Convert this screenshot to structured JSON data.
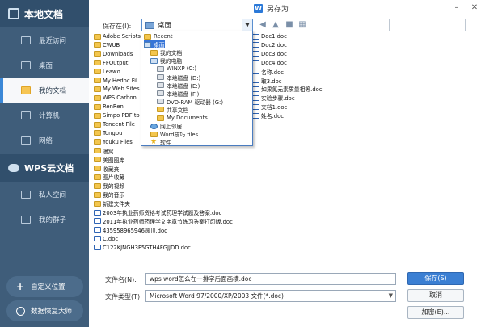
{
  "window": {
    "title": "另存为",
    "app_icon": "W",
    "minimize": "–",
    "close": "✕"
  },
  "sidebar": {
    "header": "本地文档",
    "items": [
      {
        "label": "最近访问"
      },
      {
        "label": "桌面"
      },
      {
        "label": "我的文档"
      },
      {
        "label": "计算机"
      },
      {
        "label": "网络"
      }
    ],
    "cloud_header": "WPS云文档",
    "cloud_items": [
      {
        "label": "私人空间"
      },
      {
        "label": "我的群子"
      }
    ],
    "add_location": "自定义位置",
    "recovery": "数据恢复大师"
  },
  "toolbar": {
    "save_in_label": "保存在(I):",
    "location": "桌面",
    "combo_arrow": "▼",
    "back_icon": "◀",
    "up_icon": "▲",
    "new_folder_icon": "■",
    "view_icon": "▦"
  },
  "files_left": [
    {
      "name": "Adobe Scripts",
      "type": "folder"
    },
    {
      "name": "CWUB",
      "type": "folder"
    },
    {
      "name": "Downloads",
      "type": "folder"
    },
    {
      "name": "FFOutput",
      "type": "folder"
    },
    {
      "name": "Leawo",
      "type": "folder"
    },
    {
      "name": "My Hedoc Fil",
      "type": "folder"
    },
    {
      "name": "My Web Sites",
      "type": "folder"
    },
    {
      "name": "WPS Carbon",
      "type": "folder"
    },
    {
      "name": "RenRen",
      "type": "folder"
    },
    {
      "name": "Simpo PDF to",
      "type": "folder"
    },
    {
      "name": "Tencent File",
      "type": "folder"
    },
    {
      "name": "Tongbu",
      "type": "folder"
    },
    {
      "name": "Youku Files",
      "type": "folder"
    },
    {
      "name": "漫窝",
      "type": "folder"
    },
    {
      "name": "美图图库",
      "type": "folder"
    },
    {
      "name": "收藏夹",
      "type": "folder"
    },
    {
      "name": "图片收藏",
      "type": "folder"
    },
    {
      "name": "我的视频",
      "type": "folder"
    },
    {
      "name": "我的音乐",
      "type": "folder"
    },
    {
      "name": "新建文件夹",
      "type": "folder"
    },
    {
      "name": "2003年执业药师资格考试药理学试题及答案.doc",
      "type": "doc"
    },
    {
      "name": "2011年执业药师药理学文字章节练习答案打印版.doc",
      "type": "doc"
    },
    {
      "name": "435958965946圆顶.doc",
      "type": "doc"
    },
    {
      "name": "C.doc",
      "type": "doc"
    },
    {
      "name": "C122KJNGH3F5GTH4FGJJDD.doc",
      "type": "doc"
    }
  ],
  "files_right": [
    {
      "name": "Doc1.doc",
      "type": "doc"
    },
    {
      "name": "Doc2.doc",
      "type": "doc"
    },
    {
      "name": "Doc3.doc",
      "type": "doc"
    },
    {
      "name": "Doc4.doc",
      "type": "doc"
    },
    {
      "name": "名称.doc",
      "type": "doc"
    },
    {
      "name": "取3.doc",
      "type": "doc"
    },
    {
      "name": "如果氮元素质量相等.doc",
      "type": "doc"
    },
    {
      "name": "实验步骤.doc",
      "type": "doc"
    },
    {
      "name": "文档1.doc",
      "type": "doc"
    },
    {
      "name": "姓名.doc",
      "type": "doc"
    }
  ],
  "dropdown": [
    {
      "label": "Recent",
      "type": "folder",
      "indent": 0
    },
    {
      "label": "桌面",
      "type": "pc",
      "indent": 0,
      "selected": true
    },
    {
      "label": "我的文档",
      "type": "folder",
      "indent": 1
    },
    {
      "label": "我的电脑",
      "type": "pc",
      "indent": 1
    },
    {
      "label": "WINXP (C:)",
      "type": "drive",
      "indent": 2
    },
    {
      "label": "本地磁盘 (D:)",
      "type": "drive",
      "indent": 2
    },
    {
      "label": "本地磁盘 (E:)",
      "type": "drive",
      "indent": 2
    },
    {
      "label": "本地磁盘 (F:)",
      "type": "drive",
      "indent": 2
    },
    {
      "label": "DVD-RAM 驱动器 (G:)",
      "type": "drive",
      "indent": 2
    },
    {
      "label": "共享文档",
      "type": "folder",
      "indent": 2
    },
    {
      "label": "My Documents",
      "type": "folder",
      "indent": 2
    },
    {
      "label": "网上邻居",
      "type": "net",
      "indent": 1
    },
    {
      "label": "Word技巧.files",
      "type": "folder",
      "indent": 1
    },
    {
      "label": "软件",
      "type": "star",
      "indent": 1
    }
  ],
  "bottom": {
    "filename_label": "文件名(N):",
    "filename_value": "wps word怎么在一排字后面画横.doc",
    "filetype_label": "文件类型(T):",
    "filetype_value": "Microsoft Word 97/2000/XP/2003 文件(*.doc)",
    "filetype_arrow": "▼",
    "save_button": "保存(S)",
    "cancel_button": "取消",
    "encrypt_button": "加密(E)..."
  }
}
